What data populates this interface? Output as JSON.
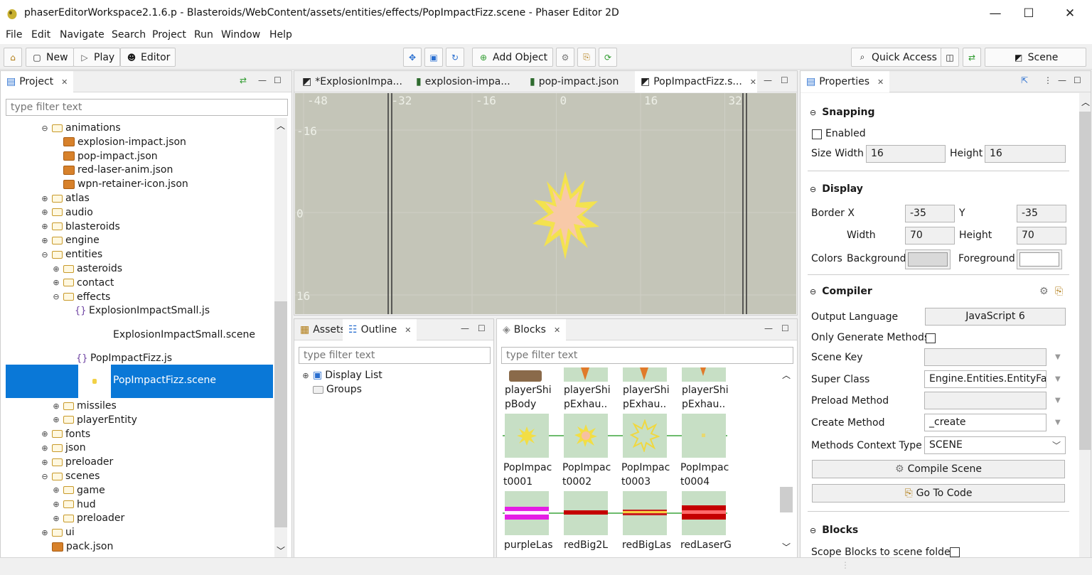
{
  "window": {
    "title": "phaserEditorWorkspace2.1.6.p - Blasteroids/WebContent/assets/entities/effects/PopImpactFizz.scene - Phaser Editor 2D",
    "minimize": "—",
    "maximize": "☐",
    "close": "✕"
  },
  "menu": [
    "File",
    "Edit",
    "Navigate",
    "Search",
    "Project",
    "Run",
    "Window",
    "Help"
  ],
  "toolbar": {
    "new": "New",
    "play": "Play",
    "editor": "Editor",
    "add_object": "Add Object",
    "quick_access": "Quick Access",
    "scene": "Scene"
  },
  "project": {
    "tab": "Project",
    "filter_placeholder": "type filter text",
    "tree": [
      {
        "label": "animations",
        "kind": "folder",
        "depth": 0,
        "exp": "⊖"
      },
      {
        "label": "explosion-impact.json",
        "kind": "json",
        "depth": 1,
        "exp": ""
      },
      {
        "label": "pop-impact.json",
        "kind": "json",
        "depth": 1,
        "exp": ""
      },
      {
        "label": "red-laser-anim.json",
        "kind": "json",
        "depth": 1,
        "exp": ""
      },
      {
        "label": "wpn-retainer-icon.json",
        "kind": "json",
        "depth": 1,
        "exp": ""
      },
      {
        "label": "atlas",
        "kind": "folder",
        "depth": 0,
        "exp": "⊕"
      },
      {
        "label": "audio",
        "kind": "folder",
        "depth": 0,
        "exp": "⊕"
      },
      {
        "label": "blasteroids",
        "kind": "folder",
        "depth": 0,
        "exp": "⊕"
      },
      {
        "label": "engine",
        "kind": "folder",
        "depth": 0,
        "exp": "⊕"
      },
      {
        "label": "entities",
        "kind": "folder",
        "depth": 0,
        "exp": "⊖"
      },
      {
        "label": "asteroids",
        "kind": "folder",
        "depth": 1,
        "exp": "⊕"
      },
      {
        "label": "contact",
        "kind": "folder",
        "depth": 1,
        "exp": "⊕"
      },
      {
        "label": "effects",
        "kind": "folder",
        "depth": 1,
        "exp": "⊖"
      },
      {
        "label": "ExplosionImpactSmall.js",
        "kind": "js",
        "depth": 2,
        "exp": ""
      }
    ],
    "scene_file_1": "ExplosionImpactSmall.scene",
    "js_file_2": "PopImpactFizz.js",
    "selected": "PopImpactFizz.scene",
    "tree_after": [
      {
        "label": "missiles",
        "kind": "folder",
        "depth": 1,
        "exp": "⊕"
      },
      {
        "label": "playerEntity",
        "kind": "folder",
        "depth": 1,
        "exp": "⊕"
      },
      {
        "label": "fonts",
        "kind": "folder",
        "depth": 0,
        "exp": "⊕"
      },
      {
        "label": "json",
        "kind": "folder",
        "depth": 0,
        "exp": "⊕"
      },
      {
        "label": "preloader",
        "kind": "folder",
        "depth": 0,
        "exp": "⊕"
      },
      {
        "label": "scenes",
        "kind": "folder",
        "depth": 0,
        "exp": "⊖"
      },
      {
        "label": "game",
        "kind": "folder",
        "depth": 1,
        "exp": "⊕"
      },
      {
        "label": "hud",
        "kind": "folder",
        "depth": 1,
        "exp": "⊕"
      },
      {
        "label": "preloader",
        "kind": "folder",
        "depth": 1,
        "exp": "⊕"
      },
      {
        "label": "ui",
        "kind": "folder",
        "depth": 0,
        "exp": "⊕"
      },
      {
        "label": "pack.json",
        "kind": "json",
        "depth": 0,
        "exp": ""
      }
    ]
  },
  "editor_tabs": [
    "*ExplosionImpa...",
    "explosion-impa...",
    "pop-impact.json",
    "PopImpactFizz.s..."
  ],
  "scene": {
    "ruler_x": [
      "-48",
      "-32",
      "-16",
      "0",
      "16",
      "32"
    ],
    "ruler_y": [
      "-16",
      "0",
      "16"
    ]
  },
  "outline": {
    "tabs": [
      "Assets",
      "Outline"
    ],
    "filter_placeholder": "type filter text",
    "items": [
      "Display List",
      "Groups"
    ]
  },
  "blocks": {
    "tab": "Blocks",
    "filter_placeholder": "type filter text",
    "row1": [
      "playerShi pBody",
      "playerShi pExhau..",
      "playerShi pExhau..",
      "playerShi pExhau.."
    ],
    "row2": [
      "PopImpac t0001",
      "PopImpac t0002",
      "PopImpac t0003",
      "PopImpac t0004"
    ],
    "row3": [
      "purpleLas",
      "redBig2L",
      "redBigLas",
      "redLaserG"
    ]
  },
  "properties": {
    "tab": "Properties",
    "snapping": {
      "title": "Snapping",
      "enabled_label": "Enabled",
      "size_width_label": "Size Width",
      "size_width": "16",
      "height_label": "Height",
      "height": "16"
    },
    "display": {
      "title": "Display",
      "border_x_label": "Border X",
      "border_x": "-35",
      "y_label": "Y",
      "y": "-35",
      "width_label": "Width",
      "width": "70",
      "height_label": "Height",
      "height": "70",
      "colors_label": "Colors",
      "background_label": "Background",
      "foreground_label": "Foreground"
    },
    "compiler": {
      "title": "Compiler",
      "output_language_label": "Output Language",
      "output_language": "JavaScript 6",
      "only_generate_label": "Only Generate Methods",
      "scene_key_label": "Scene Key",
      "scene_key": "",
      "super_class_label": "Super Class",
      "super_class": "Engine.Entities.EntityFact",
      "preload_method_label": "Preload Method",
      "preload_method": "",
      "create_method_label": "Create Method",
      "create_method": "_create",
      "context_type_label": "Methods Context Type",
      "context_type": "SCENE",
      "compile_button": "Compile Scene",
      "goto_button": "Go To Code"
    },
    "blocks": {
      "title": "Blocks",
      "scope_label": "Scope Blocks to scene folder"
    }
  },
  "colors": {
    "selection": "#0a78d7",
    "block_bg": "#c7dfc5",
    "scene_bg": "#c4c5b8"
  }
}
